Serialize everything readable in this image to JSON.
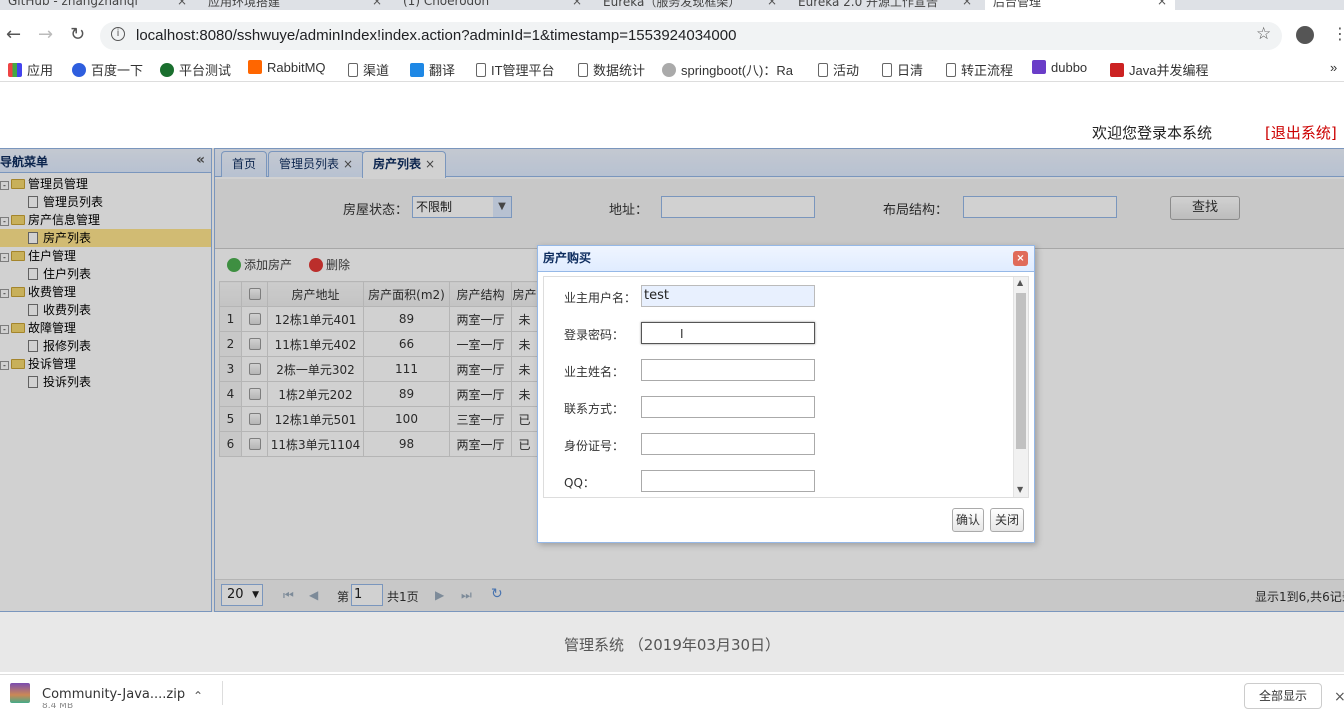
{
  "browser": {
    "tabs": [
      {
        "label": "GitHub - zhangzhanqi",
        "active": false
      },
      {
        "label": "应用环境搭建",
        "active": false
      },
      {
        "label": "(1) Choerodon",
        "active": false
      },
      {
        "label": "Eureka（服务发现框架）",
        "active": false
      },
      {
        "label": "Eureka 2.0 开源工作宣告",
        "active": false
      },
      {
        "label": "后台管理",
        "active": true
      }
    ],
    "url": "localhost:8080/sshwuye/adminIndex!index.action?adminId=1&timestamp=1553924034000",
    "bookmarks": [
      "应用",
      "百度一下",
      "平台测试",
      "RabbitMQ",
      "渠道",
      "翻译",
      "IT管理平台",
      "数据统计",
      "springboot(八)：Ra",
      "活动",
      "日清",
      "转正流程",
      "dubbo",
      "Java并发编程"
    ],
    "more_bookmarks": "»"
  },
  "header": {
    "welcome": "欢迎您登录本系统",
    "logout": "[退出系统]"
  },
  "nav": {
    "title": "导航菜单",
    "collapse": "«",
    "items": [
      {
        "label": "管理员管理",
        "type": "folder"
      },
      {
        "label": "管理员列表",
        "type": "leaf"
      },
      {
        "label": "房产信息管理",
        "type": "folder"
      },
      {
        "label": "房产列表",
        "type": "leaf",
        "selected": true
      },
      {
        "label": "住户管理",
        "type": "folder"
      },
      {
        "label": "住户列表",
        "type": "leaf"
      },
      {
        "label": "收费管理",
        "type": "folder"
      },
      {
        "label": "收费列表",
        "type": "leaf"
      },
      {
        "label": "故障管理",
        "type": "folder"
      },
      {
        "label": "报修列表",
        "type": "leaf"
      },
      {
        "label": "投诉管理",
        "type": "folder"
      },
      {
        "label": "投诉列表",
        "type": "leaf"
      }
    ]
  },
  "tabs": {
    "home": "首页",
    "admin_list": "管理员列表",
    "house_list": "房产列表",
    "close": "×"
  },
  "search": {
    "status_label": "房屋状态：",
    "status_value": "不限制",
    "address_label": "地址：",
    "layout_label": "布局结构：",
    "search_button": "查找"
  },
  "toolbar": {
    "add": "添加房产",
    "delete": "删除"
  },
  "grid": {
    "columns": [
      "房产地址",
      "房产面积(m2)",
      "房产结构",
      "房产"
    ],
    "rows": [
      {
        "n": "1",
        "address": "12栋1单元401",
        "area": "89",
        "layout": "两室一厅",
        "status": "未"
      },
      {
        "n": "2",
        "address": "11栋1单元402",
        "area": "66",
        "layout": "一室一厅",
        "status": "未"
      },
      {
        "n": "3",
        "address": "2栋一单元302",
        "area": "111",
        "layout": "两室一厅",
        "status": "未"
      },
      {
        "n": "4",
        "address": "1栋2单元202",
        "area": "89",
        "layout": "两室一厅",
        "status": "未"
      },
      {
        "n": "5",
        "address": "12栋1单元501",
        "area": "100",
        "layout": "三室一厅",
        "status": "已"
      },
      {
        "n": "6",
        "address": "11栋3单元1104",
        "area": "98",
        "layout": "两室一厅",
        "status": "已"
      }
    ]
  },
  "pager": {
    "page_size": "20",
    "page_prefix": "第",
    "page_value": "1",
    "page_total": "共1页",
    "summary": "显示1到6,共6记录"
  },
  "dialog": {
    "title": "房产购买",
    "close": "×",
    "fields": [
      {
        "label": "业主用户名：",
        "value": "test"
      },
      {
        "label": "登录密码：",
        "value": ""
      },
      {
        "label": "业主姓名：",
        "value": ""
      },
      {
        "label": "联系方式：",
        "value": ""
      },
      {
        "label": "身份证号：",
        "value": ""
      },
      {
        "label": "QQ：",
        "value": ""
      }
    ],
    "confirm": "确认",
    "cancel": "关闭"
  },
  "footer": {
    "text": "管理系统 （2019年03月30日）"
  },
  "downloads": {
    "file_name": "Community-Java....zip",
    "file_size": "8.4 MB",
    "show_all": "全部显示"
  }
}
